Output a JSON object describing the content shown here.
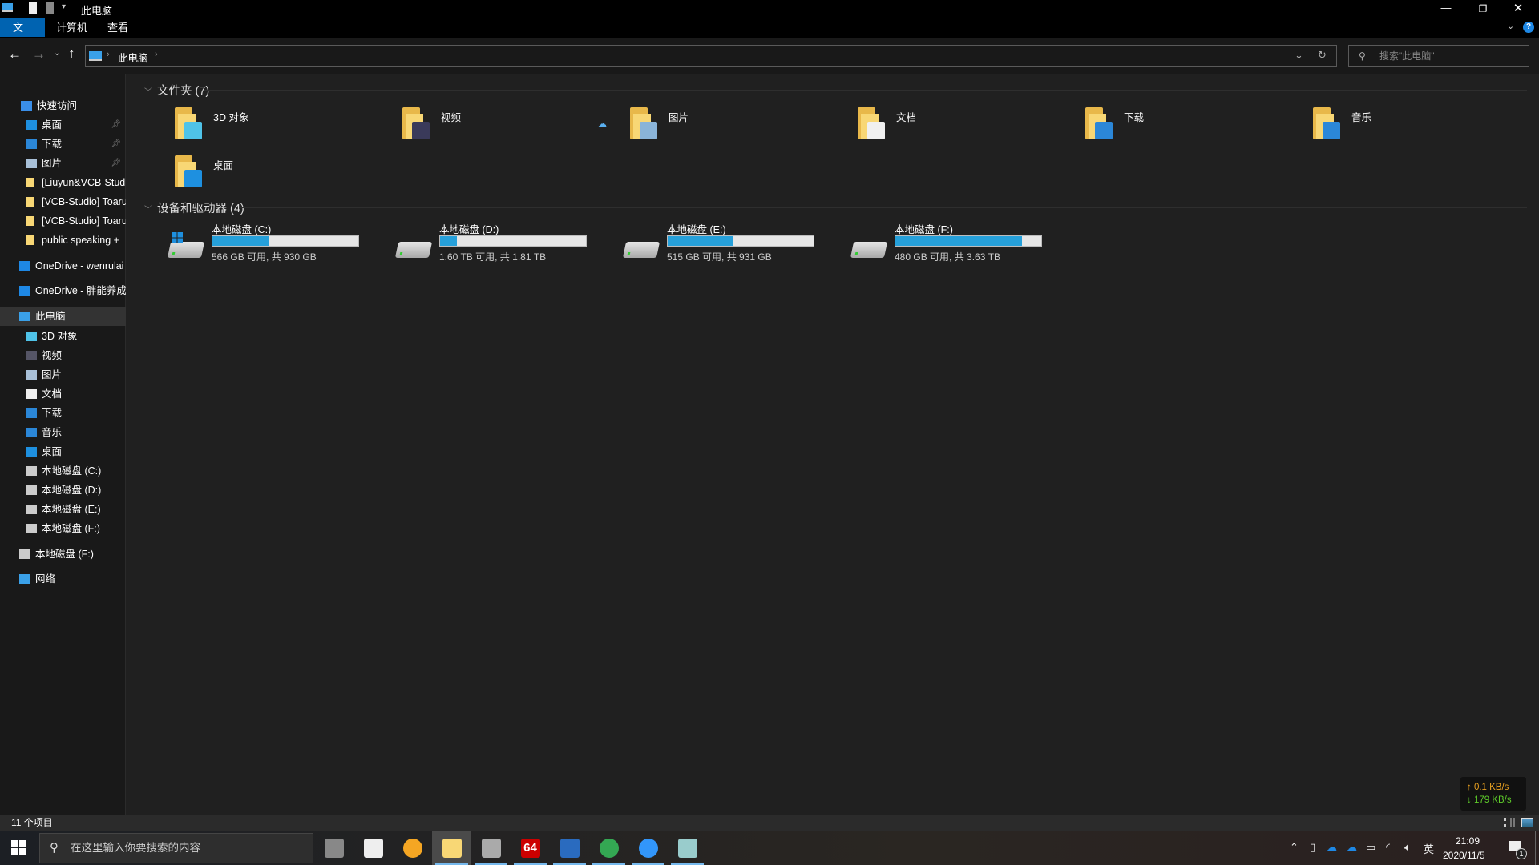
{
  "window": {
    "title": "此电脑",
    "controls": [
      "minimize",
      "restore",
      "close"
    ]
  },
  "ribbon": {
    "tabs": [
      "文件",
      "计算机",
      "查看"
    ],
    "help": "?"
  },
  "address": {
    "path": [
      "此电脑"
    ],
    "search_placeholder": "搜索\"此电脑\""
  },
  "nav": {
    "quick_access": "快速访问",
    "quick": [
      {
        "label": "桌面",
        "icon": "desktop-icon",
        "pinned": true
      },
      {
        "label": "下载",
        "icon": "download-icon",
        "pinned": true
      },
      {
        "label": "图片",
        "icon": "pictures-icon",
        "pinned": true
      },
      {
        "label": "[Liuyun&VCB-Studio]",
        "icon": "folder-icon"
      },
      {
        "label": "[VCB-Studio] Toaru",
        "icon": "folder-icon"
      },
      {
        "label": "[VCB-Studio] Toaru",
        "icon": "folder-icon"
      },
      {
        "label": "public speaking +",
        "icon": "folder-icon"
      }
    ],
    "onedrive": [
      "OneDrive - wenrulai",
      "OneDrive - 胖能养成"
    ],
    "this_pc": "此电脑",
    "pc": [
      {
        "label": "3D 对象",
        "icon": "3d-objects-icon"
      },
      {
        "label": "视频",
        "icon": "video-icon"
      },
      {
        "label": "图片",
        "icon": "pictures-icon"
      },
      {
        "label": "文档",
        "icon": "documents-icon"
      },
      {
        "label": "下载",
        "icon": "download-icon"
      },
      {
        "label": "音乐",
        "icon": "music-icon"
      },
      {
        "label": "桌面",
        "icon": "desktop-icon"
      },
      {
        "label": "本地磁盘 (C:)",
        "icon": "drive-icon"
      },
      {
        "label": "本地磁盘 (D:)",
        "icon": "drive-icon"
      },
      {
        "label": "本地磁盘 (E:)",
        "icon": "drive-icon"
      },
      {
        "label": "本地磁盘 (F:)",
        "icon": "drive-icon"
      }
    ],
    "extra_drive": "本地磁盘 (F:)",
    "network": "网络"
  },
  "folders": {
    "header": "文件夹 (7)",
    "items": [
      {
        "label": "3D 对象",
        "badge": "#4fc3e8"
      },
      {
        "label": "视频",
        "badge": "#3a3a5a"
      },
      {
        "label": "图片",
        "badge": "#8ab4d8"
      },
      {
        "label": "文档",
        "badge": "#f0f0f0"
      },
      {
        "label": "下载",
        "badge": "#2b87d8"
      },
      {
        "label": "音乐",
        "badge": "#2b87d8"
      },
      {
        "label": "桌面",
        "badge": "#1e90e0"
      }
    ]
  },
  "drives": {
    "header": "设备和驱动器 (4)",
    "items": [
      {
        "label": "本地磁盘 (C:)",
        "size": "566 GB 可用, 共 930 GB",
        "used_percent": 39.1,
        "system": true
      },
      {
        "label": "本地磁盘 (D:)",
        "size": "1.60 TB 可用, 共 1.81 TB",
        "used_percent": 11.6
      },
      {
        "label": "本地磁盘 (E:)",
        "size": "515 GB 可用, 共 931 GB",
        "used_percent": 44.7
      },
      {
        "label": "本地磁盘 (F:)",
        "size": "480 GB 可用, 共 3.63 TB",
        "used_percent": 86.8
      }
    ]
  },
  "status": {
    "count": "11 个项目"
  },
  "speed": {
    "up": "↑ 0.1 KB/s",
    "down": "↓ 179 KB/s",
    "up_color": "#e8a020",
    "down_color": "#5ecb2a"
  },
  "taskbar": {
    "search_placeholder": "在这里输入你要搜索的内容",
    "apps": [
      {
        "name": "task-view",
        "color": "#888"
      },
      {
        "name": "microsoft-store",
        "color": "#eee"
      },
      {
        "name": "weather",
        "color": "#f5a623"
      },
      {
        "name": "file-explorer",
        "color": "#f8d775",
        "active": true
      },
      {
        "name": "resource-monitor",
        "color": "#aaa"
      },
      {
        "name": "aida64",
        "color": "#c00",
        "text": "64"
      },
      {
        "name": "photos",
        "color": "#2a6bbf"
      },
      {
        "name": "chrome",
        "color": "#34a853"
      },
      {
        "name": "dingtalk",
        "color": "#3296fa"
      },
      {
        "name": "notepad",
        "color": "#9cc"
      }
    ],
    "ime": "英",
    "time": "21:09",
    "date": "2020/11/5",
    "notifications": "1"
  },
  "accent": "#0063b1"
}
